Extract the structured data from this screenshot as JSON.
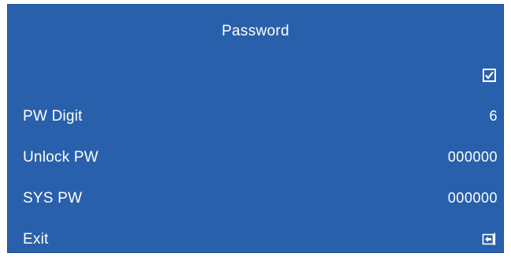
{
  "window": {
    "title": "Password"
  },
  "enable": {
    "checked": true,
    "icon": "checkbox-checked-icon"
  },
  "rows": [
    {
      "label": "PW Digit",
      "value": "6"
    },
    {
      "label": "Unlock PW",
      "value": "000000"
    },
    {
      "label": "SYS PW",
      "value": "000000"
    }
  ],
  "exit": {
    "label": "Exit",
    "icon": "return-icon"
  },
  "colors": {
    "background": "#2860ac",
    "text": "#ffffff"
  }
}
